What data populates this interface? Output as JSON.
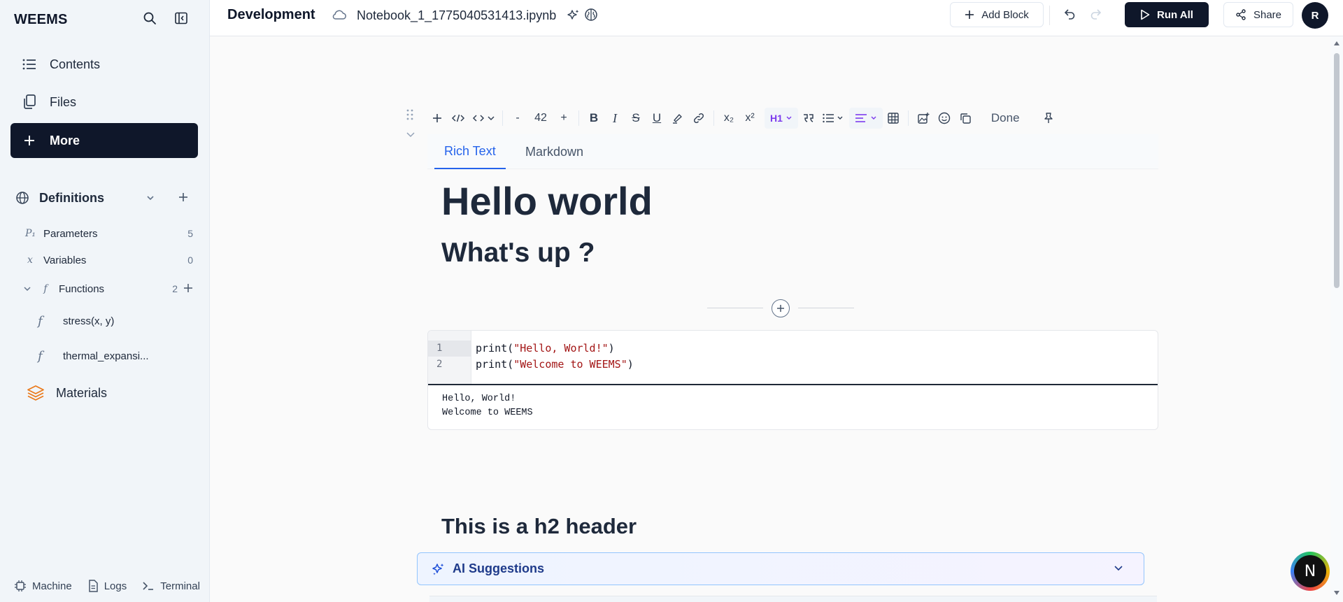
{
  "sidebar": {
    "brand": "WEEMS",
    "nav": [
      {
        "label": "Contents",
        "icon": "list-icon"
      },
      {
        "label": "Files",
        "icon": "files-icon"
      },
      {
        "label": "More",
        "icon": "plus-icon"
      }
    ],
    "definitions": {
      "label": "Definitions",
      "items": [
        {
          "glyph": "P₁",
          "label": "Parameters",
          "count": "5"
        },
        {
          "glyph": "x",
          "label": "Variables",
          "count": "0"
        },
        {
          "glyph": "f",
          "label": "Functions",
          "count": "2"
        }
      ],
      "functions": [
        {
          "glyph": "f",
          "label": "stress(x, y)"
        },
        {
          "glyph": "f",
          "label": "thermal_expansi..."
        }
      ]
    },
    "materials_label": "Materials",
    "bottom": [
      {
        "label": "Machine",
        "icon": "chip-icon"
      },
      {
        "label": "Logs",
        "icon": "file-icon"
      },
      {
        "label": "Terminal",
        "icon": "terminal-icon"
      }
    ]
  },
  "header": {
    "project": "Development",
    "notebook": "Notebook_1_1775040531413.ipynb",
    "add_block": "Add Block",
    "run_all": "Run All",
    "share": "Share",
    "avatar": "R"
  },
  "toolbar": {
    "font_size_minus": "-",
    "font_size": "42",
    "font_size_plus": "+",
    "subscript": "x₂",
    "superscript": "x²",
    "heading": "H1",
    "done": "Done"
  },
  "editor": {
    "tabs": [
      "Rich Text",
      "Markdown"
    ],
    "heading1": "Hello world",
    "heading2": "What's up ?",
    "code_lines": [
      {
        "num": "1",
        "fn": "print(",
        "str": "\"Hello, World!\"",
        "end": ")"
      },
      {
        "num": "2",
        "fn": "print(",
        "str": "\"Welcome to WEEMS\"",
        "end": ")"
      }
    ],
    "output": [
      "Hello, World!",
      "Welcome to WEEMS"
    ],
    "heading3": "This is a h2 header",
    "ai_suggestions": "AI Suggestions"
  },
  "floating_badge": "N",
  "colors": {
    "accent": "#0f172a",
    "tab_active": "#2563eb",
    "heading_purple": "#7c3aed",
    "code_string": "#a31515",
    "materials_orange": "#ea7a1c"
  }
}
